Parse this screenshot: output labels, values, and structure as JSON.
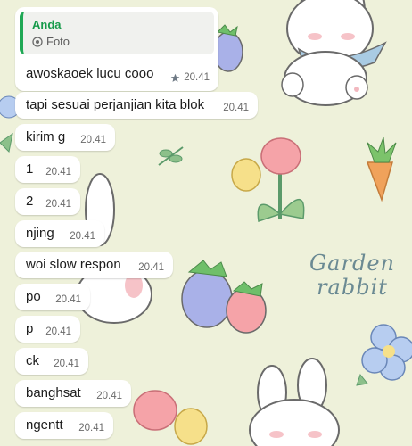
{
  "wallpaper": {
    "caption": [
      "Garden",
      "rabbit"
    ]
  },
  "chat": {
    "reply": {
      "author": "Anda",
      "media_icon": "camera-icon",
      "media_label": "Foto",
      "text": "awoskaoek lucu cooo",
      "time": "20.41",
      "starred": true,
      "accent_color": "#1fa855"
    },
    "messages": [
      {
        "text": "tapi sesuai perjanjian kita blok",
        "time": "20.41"
      },
      {
        "text": "kirim g",
        "time": "20.41"
      },
      {
        "text": "1",
        "time": "20.41"
      },
      {
        "text": "2",
        "time": "20.41"
      },
      {
        "text": "njing",
        "time": "20.41"
      },
      {
        "text": "woi slow respon",
        "time": "20.41"
      },
      {
        "text": "po",
        "time": "20.41"
      },
      {
        "text": "p",
        "time": "20.41"
      },
      {
        "text": "ck",
        "time": "20.41"
      },
      {
        "text": "banghsat",
        "time": "20.41"
      },
      {
        "text": "ngentt",
        "time": "20.41"
      }
    ]
  }
}
